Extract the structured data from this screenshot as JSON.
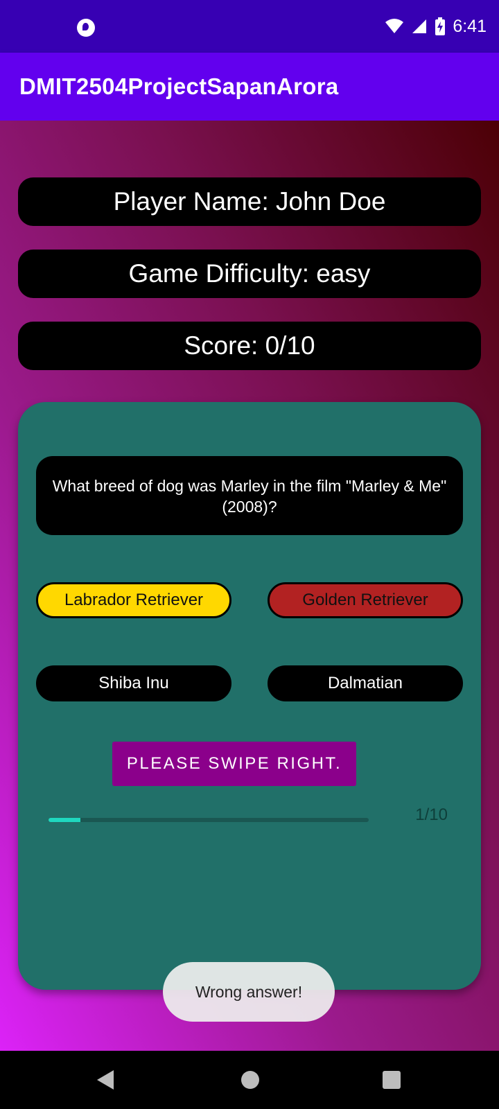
{
  "status_bar": {
    "time": "6:41",
    "icons": [
      "app-notification-icon",
      "wifi-icon",
      "cellular-signal-icon",
      "battery-charging-icon"
    ]
  },
  "app_bar": {
    "title": "DMIT2504ProjectSapanArora",
    "color": "#6200ee"
  },
  "info": {
    "player": "Player Name: John Doe",
    "difficulty": "Game Difficulty: easy",
    "score": "Score: 0/10"
  },
  "question": {
    "text": "What breed of dog was Marley in the film \"Marley & Me\" (2008)?",
    "answers": [
      {
        "label": "Labrador Retriever",
        "state": "correct",
        "color": "#ffd800"
      },
      {
        "label": "Golden Retriever",
        "state": "wrong",
        "color": "#b22222"
      },
      {
        "label": "Shiba Inu",
        "state": "default",
        "color": "#000000"
      },
      {
        "label": "Dalmatian",
        "state": "default",
        "color": "#000000"
      }
    ]
  },
  "swipe_button": {
    "label": "PLEASE SWIPE RIGHT."
  },
  "progress": {
    "text": "1/10",
    "value": 0.1,
    "color": "#1fd8bf"
  },
  "toast": {
    "text": "Wrong answer!"
  },
  "nav_bar": {
    "icons": [
      "back-icon",
      "home-icon",
      "recents-icon"
    ]
  },
  "colors": {
    "card": "#217069",
    "swipe_button": "#8b008b",
    "status_bar": "#3700b3"
  }
}
